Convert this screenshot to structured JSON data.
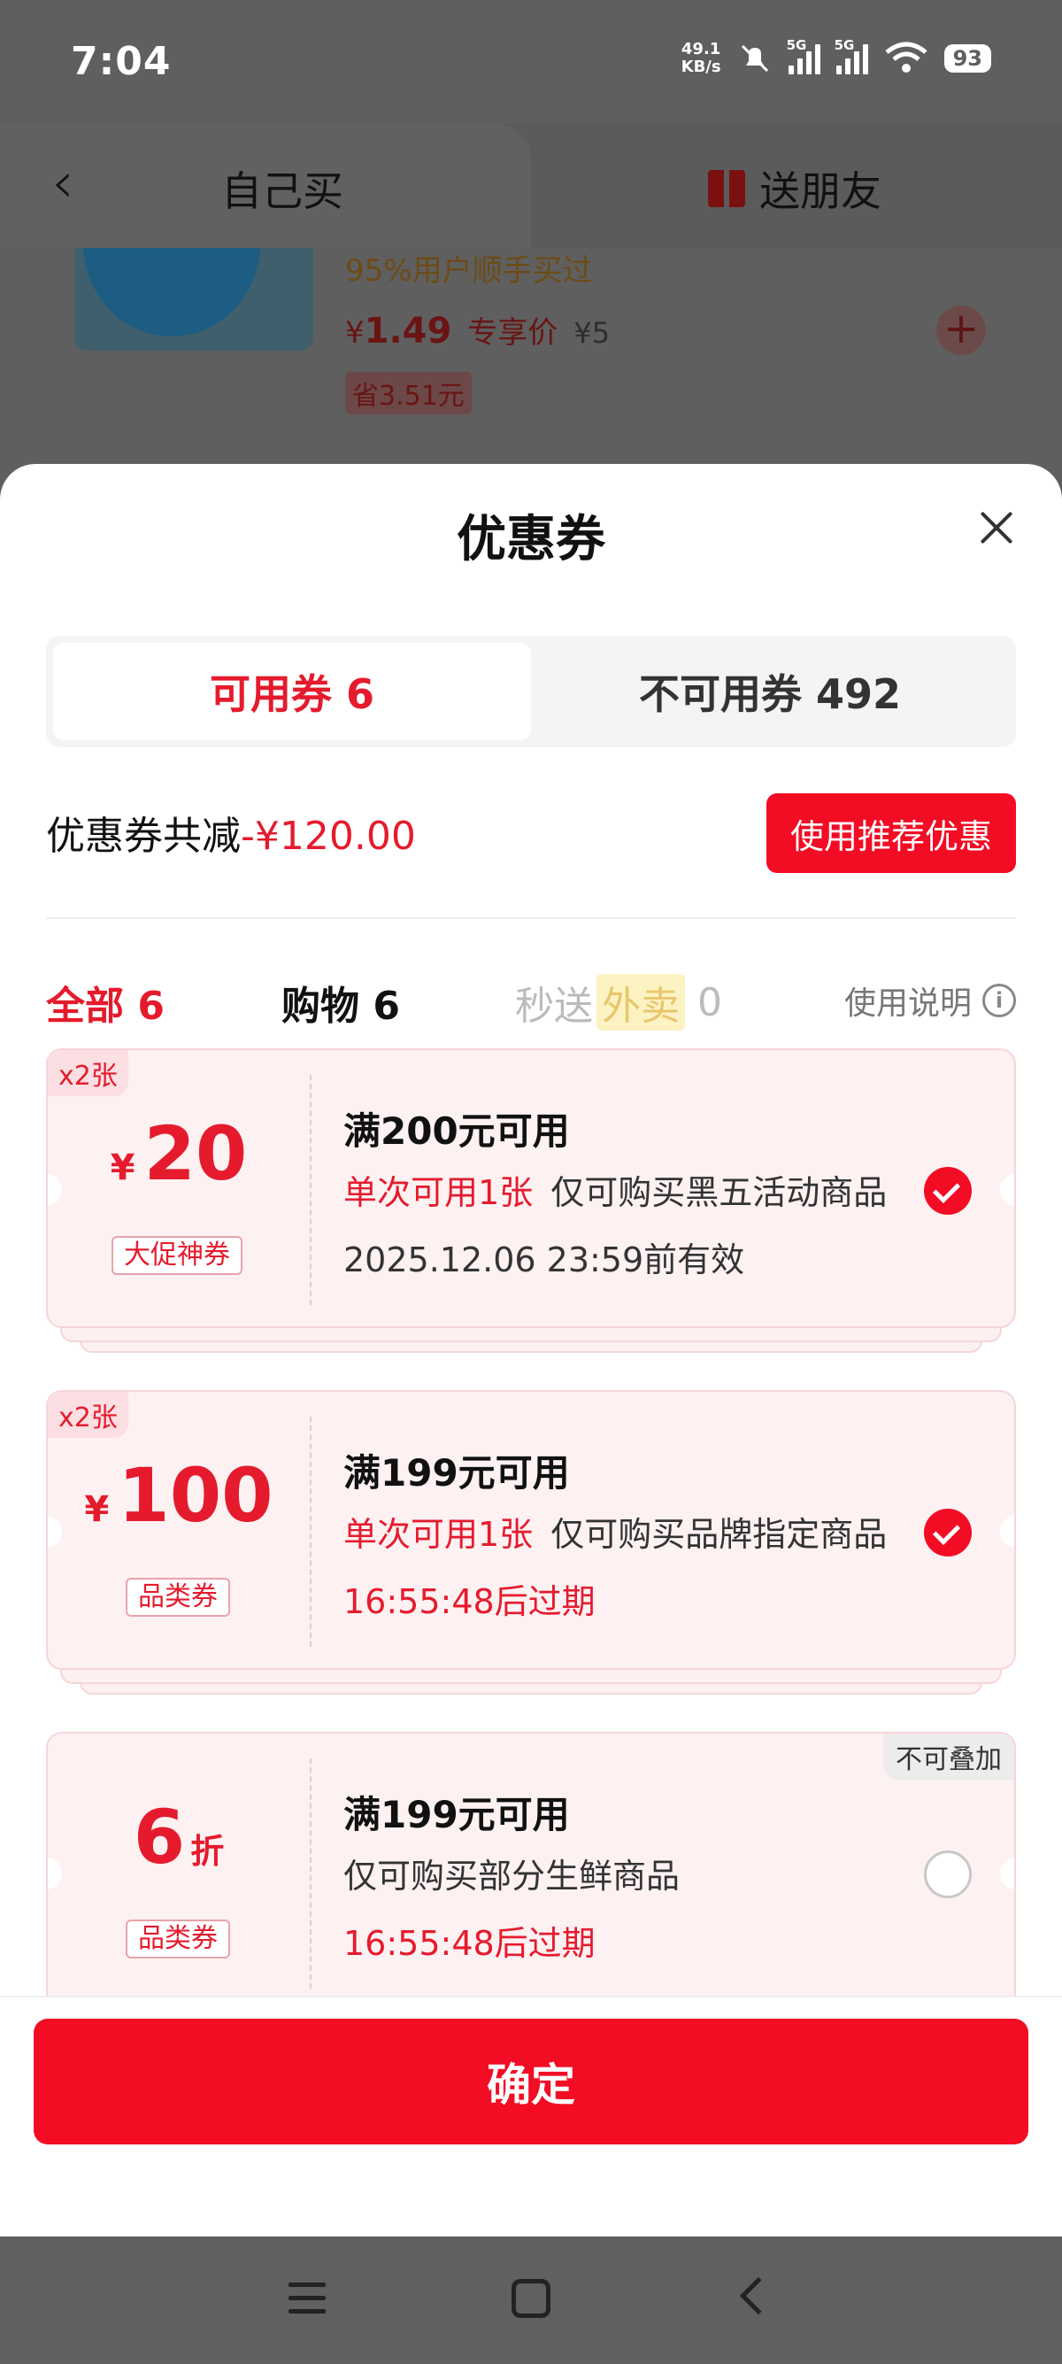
{
  "status": {
    "time": "7:04",
    "net_speed_value": "49.1",
    "net_speed_unit": "KB/s",
    "sim1": "5G",
    "sim2": "5G",
    "battery": "93"
  },
  "background": {
    "tab_self": "自己买",
    "tab_friend": "送朋友",
    "product_note": "95%用户顺手买过",
    "price_symbol": "¥",
    "price": "1.49",
    "price_tag": "专享价",
    "original_price": "¥5",
    "saving": "省3.51元"
  },
  "sheet": {
    "title": "优惠券",
    "tab_available": "可用券 6",
    "tab_unavailable": "不可用券 492",
    "total_label": "优惠券共减",
    "total_amount": "-¥120.00",
    "recommend_button": "使用推荐优惠",
    "filters": {
      "all": "全部 6",
      "shopping": "购物 6",
      "flash_prefix": "秒送",
      "flash_tag": "外卖",
      "flash_count": "0",
      "help": "使用说明"
    }
  },
  "coupons": [
    {
      "badge": "x2张",
      "symbol": "¥",
      "amount": "20",
      "type": "大促神券",
      "condition": "满200元可用",
      "limit": "单次可用1张",
      "scope": "仅可购买黑五活动商品",
      "validity": "2025.12.06 23:59前有效",
      "selected": true
    },
    {
      "badge": "x2张",
      "symbol": "¥",
      "amount": "100",
      "type": "品类券",
      "condition": "满199元可用",
      "limit": "单次可用1张",
      "scope": "仅可购买品牌指定商品",
      "validity": "16:55:48后过期",
      "selected": true
    },
    {
      "badge": "不可叠加",
      "amount": "6",
      "unit": "折",
      "type": "品类券",
      "condition": "满199元可用",
      "scope": "仅可购买部分生鲜商品",
      "validity": "16:55:48后过期",
      "selected": false
    }
  ],
  "confirm_button": "确定",
  "colors": {
    "accent": "#f20c24",
    "accent_text": "#e51b2d",
    "coupon_bg": "#fdf1f2"
  }
}
